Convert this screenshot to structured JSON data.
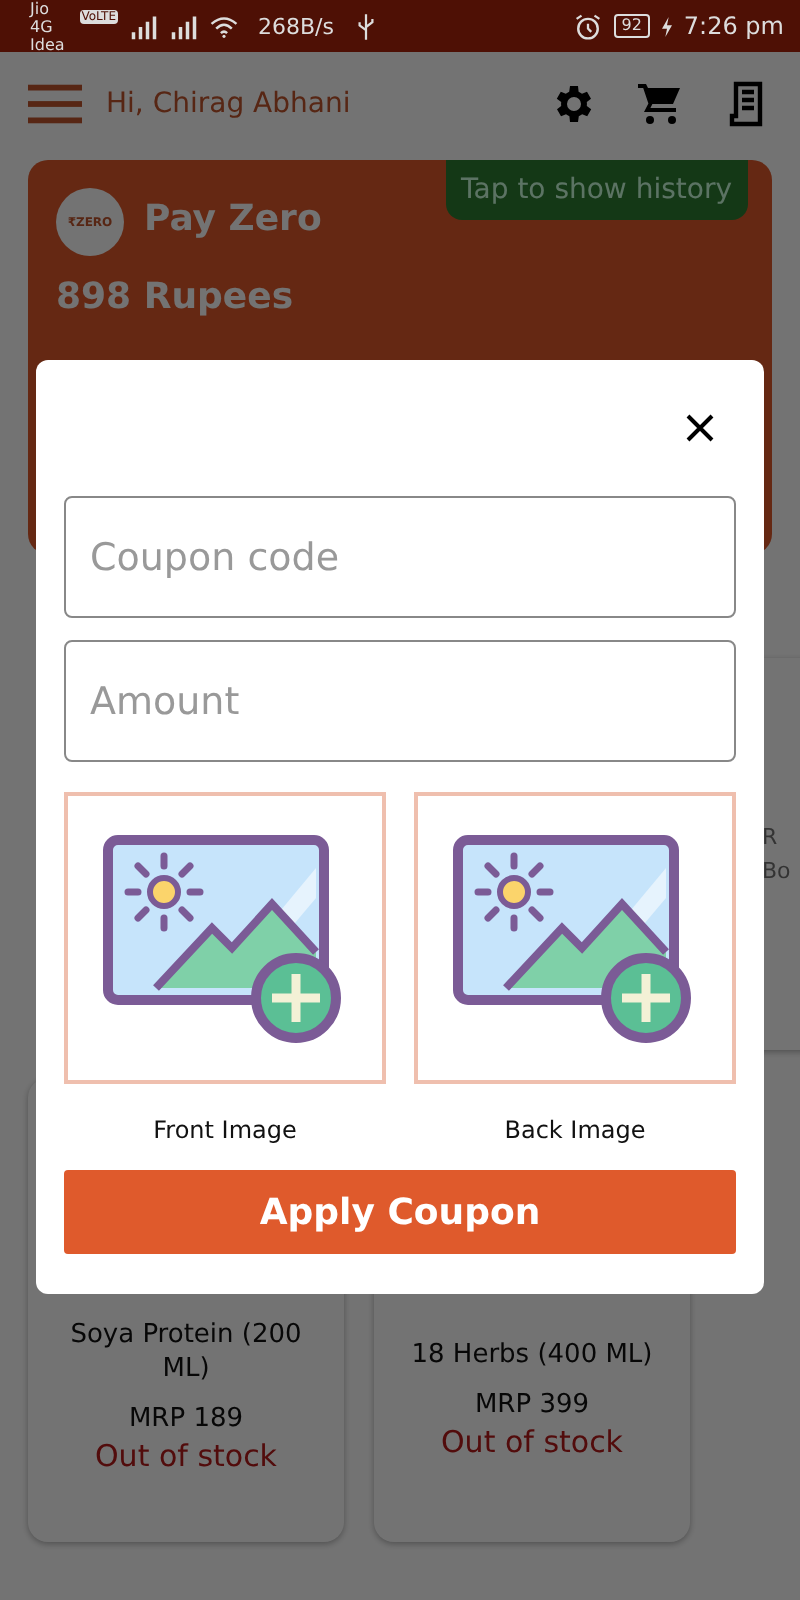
{
  "status_bar": {
    "carrier": "Jio 4G",
    "volte": "VoLTE",
    "carrier_2": "Idea",
    "speed": "268B/s",
    "battery": "92",
    "time": "7:26 pm"
  },
  "header": {
    "greeting": "Hi, Chirag Abhani"
  },
  "wallet": {
    "logo": "₹ZERO",
    "title": "Pay Zero",
    "balance": "898 Rupees",
    "history_button": "Tap to show history"
  },
  "partial_product": {
    "name": "R Bo"
  },
  "products": [
    {
      "name": "Soya Protein (200 ML)",
      "price": "MRP 189",
      "stock": "Out of stock"
    },
    {
      "name": "18 Herbs (400 ML)",
      "price": "MRP 399",
      "stock": "Out of stock"
    }
  ],
  "dialog": {
    "fields": [
      {
        "placeholder": "Coupon code"
      },
      {
        "placeholder": "Amount"
      }
    ],
    "image_slots": [
      {
        "label": "Front Image"
      },
      {
        "label": "Back Image"
      }
    ],
    "apply_button": "Apply Coupon"
  }
}
